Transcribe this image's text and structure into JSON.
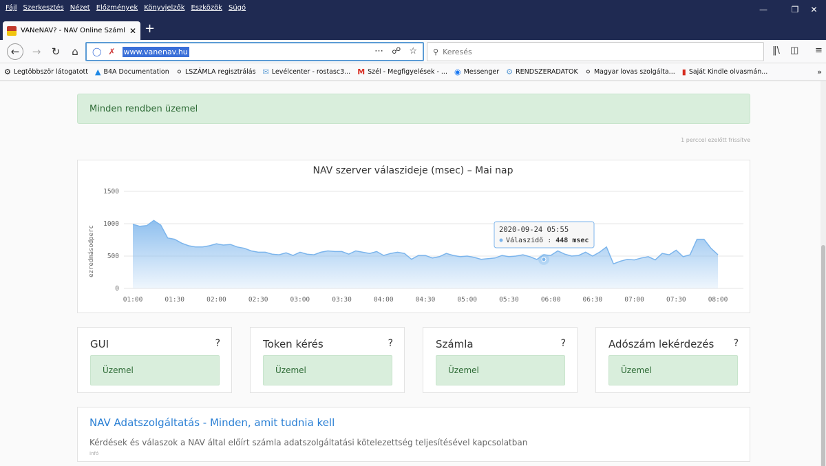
{
  "menu": [
    "Fájl",
    "Szerkesztés",
    "Nézet",
    "Előzmények",
    "Könyvjelzők",
    "Eszközök",
    "Súgó"
  ],
  "tab": {
    "title": "VANeNAV? - NAV Online Száml"
  },
  "url": "www.vanenav.hu",
  "search": {
    "placeholder": "Keresés"
  },
  "bookmarks": [
    {
      "icon": "gear-icon",
      "label": "Legtöbbször látogatott"
    },
    {
      "icon": "b4a-icon",
      "label": "B4A Documentation"
    },
    {
      "icon": "globe-icon",
      "label": "LSZÁMLA regisztrálás"
    },
    {
      "icon": "mail-icon",
      "label": "Levélcenter - rostasc3..."
    },
    {
      "icon": "gmail-icon",
      "label": "Szél - Megfigyelések - ..."
    },
    {
      "icon": "messenger-icon",
      "label": "Messenger"
    },
    {
      "icon": "server-icon",
      "label": "RENDSZERADATOK"
    },
    {
      "icon": "globe-icon",
      "label": "Magyar lovas szolgálta..."
    },
    {
      "icon": "flag-icon",
      "label": "Saját Kindle olvasmán..."
    }
  ],
  "page": {
    "status_text": "Minden rendben üzemel",
    "refreshed": "1 perccel ezelőtt frissítve",
    "services": [
      {
        "name": "GUI",
        "status": "Üzemel"
      },
      {
        "name": "Token kérés",
        "status": "Üzemel"
      },
      {
        "name": "Számla",
        "status": "Üzemel"
      },
      {
        "name": "Adószám lekérdezés",
        "status": "Üzemel"
      }
    ],
    "info": {
      "title": "NAV Adatszolgáltatás - Minden, amit tudnia kell",
      "text": "Kérdések és válaszok a NAV által előírt számla adatszolgáltatási kötelezettség teljesítésével kapcsolatban",
      "tag": "Infó"
    }
  },
  "chart_data": {
    "type": "area",
    "title": "NAV szerver válaszideje (msec) – Mai nap",
    "ylabel": "ezredmásodperc",
    "ylim": [
      0,
      1500
    ],
    "yticks": [
      0,
      500,
      1000,
      1500
    ],
    "xticks": [
      "01:00",
      "01:30",
      "02:00",
      "02:30",
      "03:00",
      "03:30",
      "04:00",
      "04:30",
      "05:00",
      "05:30",
      "06:00",
      "06:30",
      "07:00",
      "07:30",
      "08:00"
    ],
    "x_minutes": [
      0,
      5,
      10,
      15,
      20,
      25,
      30,
      35,
      40,
      45,
      50,
      55,
      60,
      65,
      70,
      75,
      80,
      85,
      90,
      95,
      100,
      105,
      110,
      115,
      120,
      125,
      130,
      135,
      140,
      145,
      150,
      155,
      160,
      165,
      170,
      175,
      180,
      185,
      190,
      195,
      200,
      205,
      210,
      215,
      220,
      225,
      230,
      235,
      240,
      245,
      250,
      255,
      260,
      265,
      270,
      275,
      280,
      285,
      290,
      295,
      300,
      305,
      310,
      315,
      320,
      325,
      330,
      335,
      340,
      345,
      350,
      355,
      360,
      365,
      370,
      375,
      380,
      385,
      390,
      395,
      400,
      405,
      410,
      415,
      420,
      425,
      430,
      435
    ],
    "values": [
      990,
      960,
      970,
      1050,
      980,
      780,
      760,
      700,
      660,
      640,
      640,
      660,
      690,
      670,
      680,
      640,
      620,
      580,
      560,
      560,
      530,
      520,
      550,
      510,
      560,
      530,
      520,
      560,
      580,
      570,
      570,
      530,
      580,
      560,
      540,
      570,
      510,
      540,
      560,
      540,
      450,
      510,
      510,
      470,
      490,
      540,
      510,
      490,
      500,
      480,
      450,
      460,
      470,
      510,
      490,
      500,
      520,
      490,
      448,
      520,
      510,
      580,
      530,
      500,
      510,
      560,
      500,
      560,
      640,
      380,
      420,
      450,
      440,
      470,
      490,
      440,
      540,
      520,
      590,
      490,
      520,
      760,
      760,
      620,
      520
    ],
    "tooltip": {
      "time": "2020-09-24 05:55",
      "series": "Válaszidő",
      "value_text": "448 msec"
    }
  }
}
